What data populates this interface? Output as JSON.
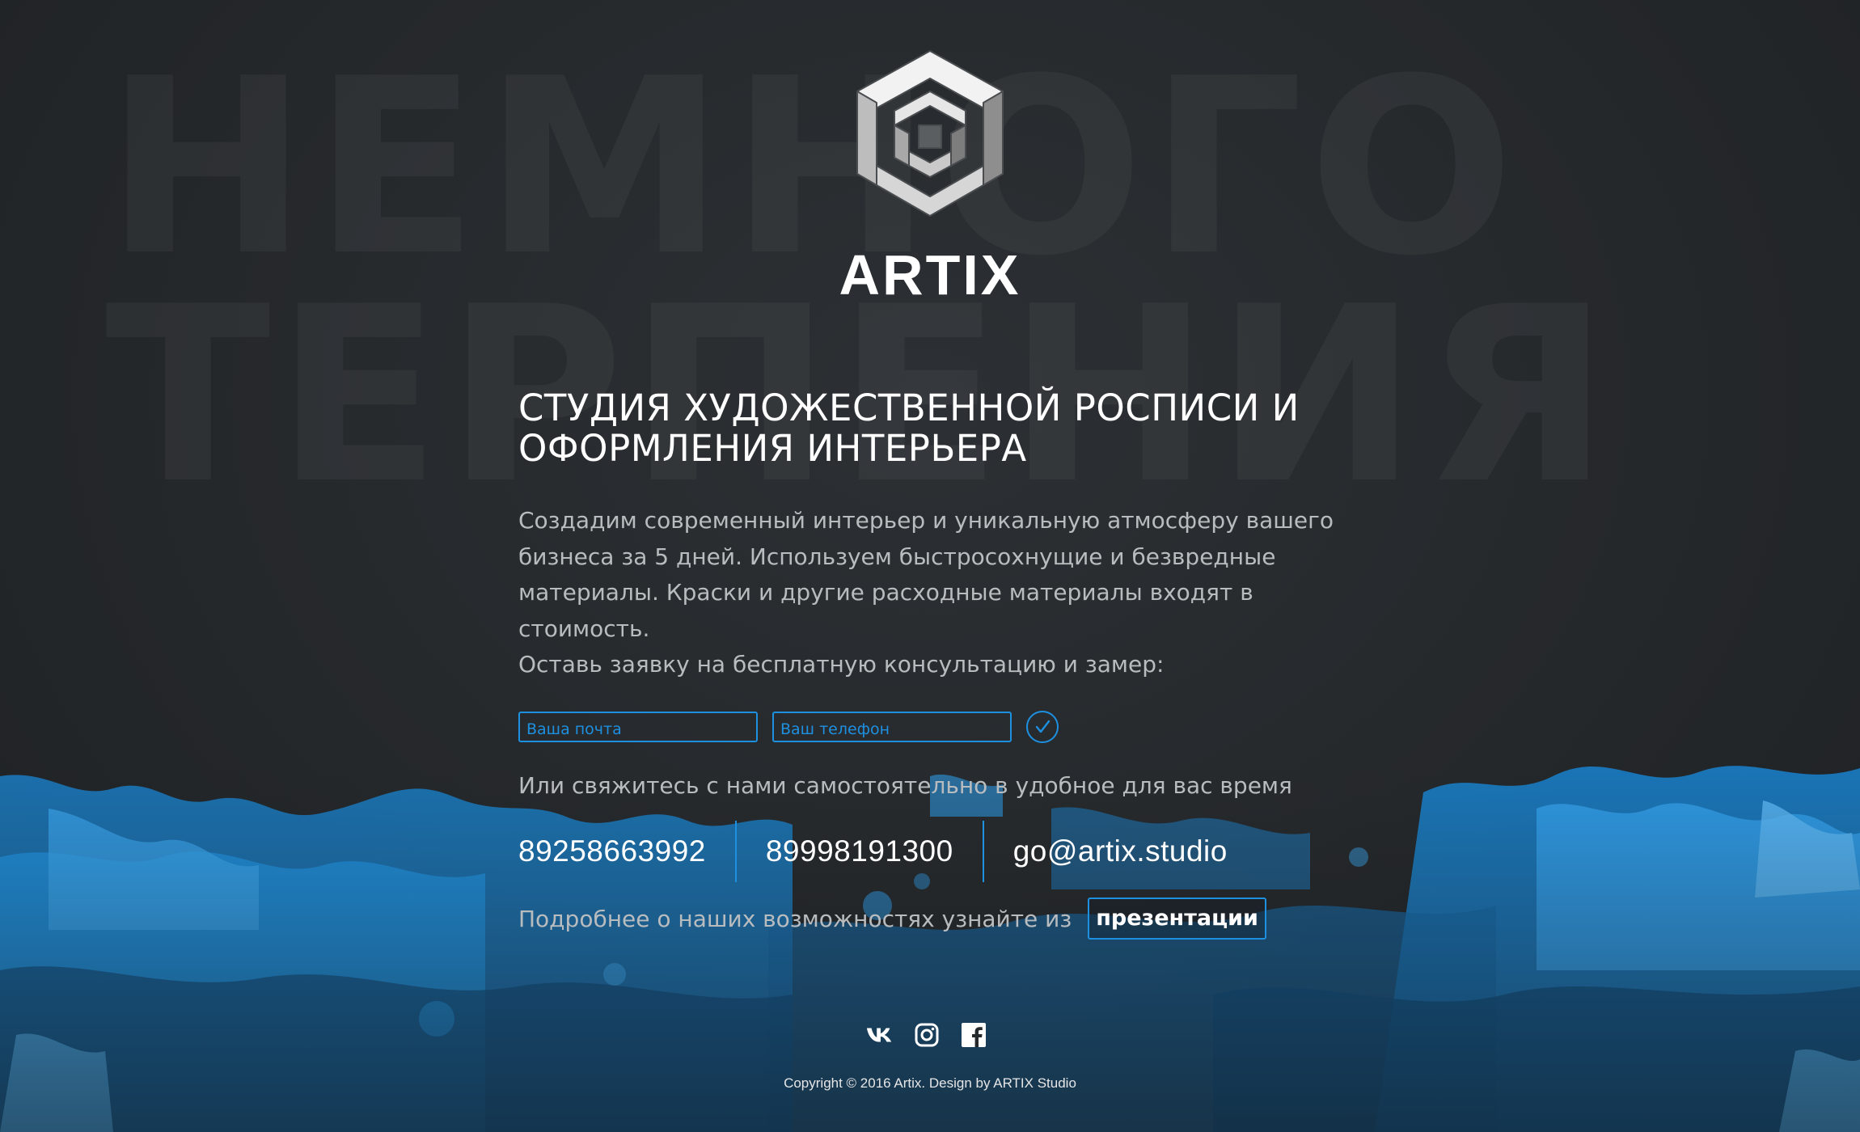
{
  "background": {
    "word_line1": "НЕМНОГО",
    "word_line2": "ТЕРПЕНИЯ"
  },
  "brand": {
    "name": "ARTIX",
    "logo_icon": "impossible-cube-logo-icon"
  },
  "hero": {
    "headline": "СТУДИЯ ХУДОЖЕСТВЕННОЙ РОСПИСИ И ОФОРМЛЕНИЯ ИНТЕРЬЕРА",
    "description": "Создадим современный интерьер и уникальную атмосферу вашего бизнеса за 5 дней. Используем быстросохнущие и безвредные материалы. Краски и другие расходные материалы входят в стоимость.",
    "cta_text": "Оставь заявку на бесплатную консультацию и замер:"
  },
  "form": {
    "email_placeholder": "Ваша почта",
    "phone_placeholder": "Ваш телефон",
    "submit_icon": "checkmark-circle-icon"
  },
  "contacts": {
    "intro": "Или свяжитесь с нами самостоятельно в удобное для вас время",
    "phone1": "89258663992",
    "phone2": "89998191300",
    "email": "go@artix.studio"
  },
  "presentation": {
    "text": "Подробнее о наших возможностях узнайте из",
    "button_label": "презентации"
  },
  "social": {
    "icons": [
      "vk-icon",
      "instagram-icon",
      "facebook-icon"
    ]
  },
  "footer": {
    "copyright": "Copyright © 2016 Artix. Design by ARTIX Studio"
  },
  "colors": {
    "accent": "#1e90e0",
    "background": "#26292c",
    "text_primary": "#ffffff",
    "text_secondary": "#b9bcbf"
  }
}
